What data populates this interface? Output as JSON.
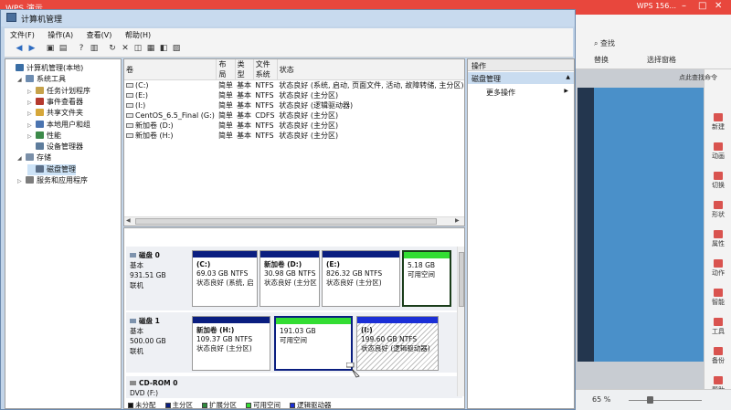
{
  "wps": {
    "title": "WPS 演示",
    "tab_text": "WPS 156...",
    "find_label": "查找",
    "replace_label": "替换",
    "select_pane_label": "选择窗格",
    "search_text": "点此查找命令",
    "side_items": [
      "新建",
      "动画",
      "切换",
      "形状",
      "属性",
      "动作",
      "智能",
      "工具",
      "备份",
      "帮助"
    ],
    "zoom": "65 %"
  },
  "window": {
    "title": "计算机管理",
    "menu": [
      "文件(F)",
      "操作(A)",
      "查看(V)",
      "帮助(H)"
    ]
  },
  "tree": {
    "items": [
      {
        "label": "计算机管理(本地)",
        "level": 0,
        "expander": "",
        "color": "#3a6ea5"
      },
      {
        "label": "系统工具",
        "level": 1,
        "expander": "◢",
        "color": "#6d8cb0"
      },
      {
        "label": "任务计划程序",
        "level": 2,
        "expander": "▷",
        "color": "#c6a24a"
      },
      {
        "label": "事件查看器",
        "level": 2,
        "expander": "▷",
        "color": "#b53a2e"
      },
      {
        "label": "共享文件夹",
        "level": 2,
        "expander": "▷",
        "color": "#d6a73a"
      },
      {
        "label": "本地用户和组",
        "level": 2,
        "expander": "▷",
        "color": "#4b74b0"
      },
      {
        "label": "性能",
        "level": 2,
        "expander": "▷",
        "color": "#3c8a4a"
      },
      {
        "label": "设备管理器",
        "level": 2,
        "expander": "",
        "color": "#5d7c9c"
      },
      {
        "label": "存储",
        "level": 1,
        "expander": "◢",
        "color": "#7a8fa8"
      },
      {
        "label": "磁盘管理",
        "level": 2,
        "expander": "",
        "color": "#5c6f88",
        "selected": true
      },
      {
        "label": "服务和应用程序",
        "level": 1,
        "expander": "▷",
        "color": "#7d7d7d"
      }
    ]
  },
  "volumes": {
    "headers": [
      "卷",
      "布局",
      "类型",
      "文件系统",
      "状态"
    ],
    "rows": [
      [
        "(C:)",
        "简单",
        "基本",
        "NTFS",
        "状态良好 (系统, 启动, 页面文件, 活动, 故障转储, 主分区)"
      ],
      [
        "(E:)",
        "简单",
        "基本",
        "NTFS",
        "状态良好 (主分区)"
      ],
      [
        "(I:)",
        "简单",
        "基本",
        "NTFS",
        "状态良好 (逻辑驱动器)"
      ],
      [
        "CentOS_6.5_Final (G:)",
        "简单",
        "基本",
        "CDFS",
        "状态良好 (主分区)"
      ],
      [
        "新加卷 (D:)",
        "简单",
        "基本",
        "NTFS",
        "状态良好 (主分区)"
      ],
      [
        "新加卷 (H:)",
        "简单",
        "基本",
        "NTFS",
        "状态良好 (主分区)"
      ]
    ]
  },
  "disks": [
    {
      "name": "磁盘 0",
      "type": "基本",
      "size": "931.51 GB",
      "status": "联机",
      "partitions": [
        {
          "l1": "(C:)",
          "l2": "69.03 GB NTFS",
          "l3": "状态良好 (系统, 启",
          "kind": "primary"
        },
        {
          "l1": "新加卷 (D:)",
          "l2": "30.98 GB NTFS",
          "l3": "状态良好 (主分区",
          "kind": "primary"
        },
        {
          "l1": "(E:)",
          "l2": "826.32 GB NTFS",
          "l3": "状态良好 (主分区)",
          "kind": "primary"
        },
        {
          "l1": "",
          "l2": "5.18 GB",
          "l3": "可用空间",
          "kind": "free"
        }
      ]
    },
    {
      "name": "磁盘 1",
      "type": "基本",
      "size": "500.00 GB",
      "status": "联机",
      "partitions": [
        {
          "l1": "新加卷 (H:)",
          "l2": "109.37 GB NTFS",
          "l3": "状态良好 (主分区)",
          "kind": "primary"
        },
        {
          "l1": "",
          "l2": "191.03 GB",
          "l3": "可用空间",
          "kind": "free"
        },
        {
          "l1": "(I:)",
          "l2": "199.60 GB NTFS",
          "l3": "状态良好 (逻辑驱动器)",
          "kind": "logical"
        }
      ]
    },
    {
      "name": "CD-ROM 0",
      "type": "DVD (F:)"
    }
  ],
  "legend": [
    {
      "label": "未分配",
      "color": "#111111"
    },
    {
      "label": "主分区",
      "color": "#0a1e80"
    },
    {
      "label": "扩展分区",
      "color": "#2d8a3a"
    },
    {
      "label": "可用空间",
      "color": "#33dd33"
    },
    {
      "label": "逻辑驱动器",
      "color": "#1b2fd6"
    }
  ],
  "actions": {
    "header": "操作",
    "section": "磁盘管理",
    "more": "更多操作"
  }
}
